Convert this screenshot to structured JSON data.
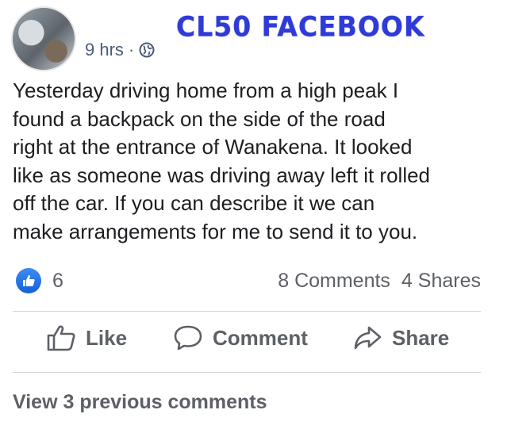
{
  "post": {
    "time": "9 hrs",
    "separator": "·",
    "privacy_icon": "globe-icon",
    "brand_overlay": "CL50 FACEBOOK",
    "text": "Yesterday driving home from a high peak I\nfound a backpack on the side of the road\nright at the entrance of Wanakena.  It looked\nlike as someone was driving away left it rolled\noff the car.  If you can describe it we can\nmake arrangements for me to send it to you."
  },
  "stats": {
    "reaction_icon": "like-reaction-icon",
    "reaction_count": "6",
    "comments": "8 Comments",
    "shares": "4 Shares"
  },
  "actions": {
    "like": "Like",
    "comment": "Comment",
    "share": "Share"
  },
  "comments": {
    "view_previous": "View 3 previous comments"
  },
  "colors": {
    "brand_overlay": "#2f3bd6",
    "like_blue": "#1877f2",
    "meta_text": "#4a5a7c",
    "secondary_text": "#5d6066"
  }
}
